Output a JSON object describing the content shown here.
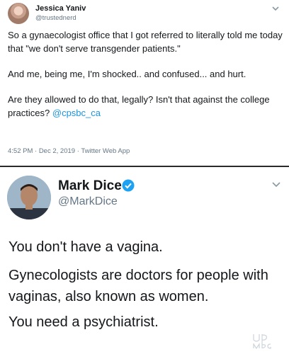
{
  "tweet1": {
    "name": "Jessica Yaniv",
    "handle": "@trustednerd",
    "para1": "So a gynaecologist office that I got referred to literally told me today that \"we don't serve transgender patients.\"",
    "para2": "And me, being me, I'm shocked.. and confused... and hurt.",
    "para3_text": "Are they allowed to do that, legally? Isn't that against the college practices?",
    "para3_mention": "@cpsbc_ca",
    "meta": "4:52 PM · Dec 2, 2019 · Twitter Web App"
  },
  "tweet2": {
    "name": "Mark Dice",
    "handle": "@MarkDice",
    "line1": "You don't have a vagina.",
    "line2": "Gynecologists are doctors for people with vaginas, also known as women.",
    "line3": "You need a psychiatrist."
  },
  "icons": {
    "chevron": "chevron-down-icon",
    "verified": "verified-badge-icon"
  },
  "colors": {
    "text": "#14171a",
    "muted": "#657786",
    "link": "#1b95e0",
    "verified": "#1da1f2"
  }
}
